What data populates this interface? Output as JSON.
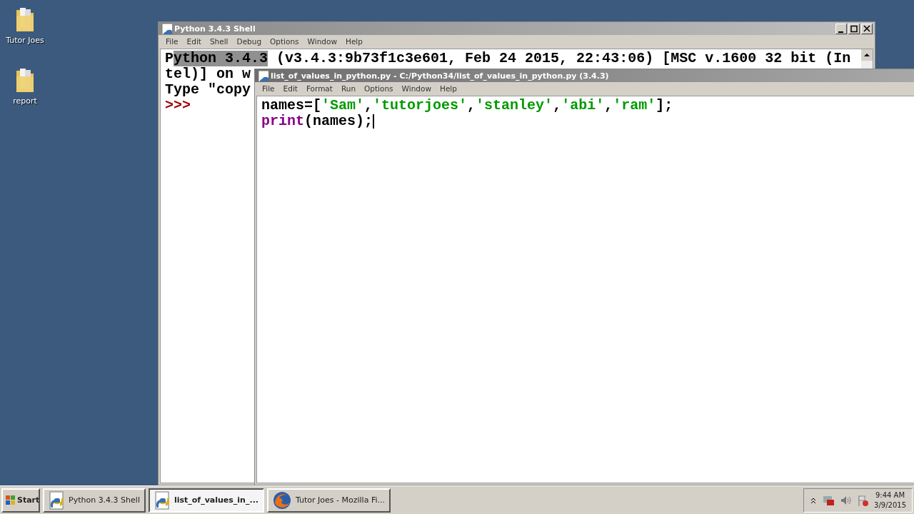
{
  "desktop_icons": [
    {
      "label": "Tutor Joes"
    },
    {
      "label": "report"
    }
  ],
  "shell_window": {
    "title": "Python 3.4.3 Shell",
    "active": false,
    "menu": [
      "File",
      "Edit",
      "Shell",
      "Debug",
      "Options",
      "Window",
      "Help"
    ],
    "lines": [
      [
        {
          "text": "P",
          "selected": false
        },
        {
          "text": "ython 3.4.3",
          "selected": true
        },
        {
          "text": " (v3.4.3:9b73f1c3e601, Feb 24 2015, 22:43:06) [MSC v.1600 32 bit (In",
          "selected": false
        }
      ],
      [
        {
          "text": "tel)] on w",
          "selected": false
        }
      ],
      [
        {
          "text": "Type \"copy",
          "selected": false
        }
      ]
    ],
    "prompt": ">>>"
  },
  "editor_window": {
    "title": "list_of_values_in_python.py - C:/Python34/list_of_values_in_python.py (3.4.3)",
    "active": true,
    "menu": [
      "File",
      "Edit",
      "Format",
      "Run",
      "Options",
      "Window",
      "Help"
    ],
    "code_lines": [
      [
        {
          "text": "names=[",
          "kind": "plain"
        },
        {
          "text": "'Sam'",
          "kind": "string"
        },
        {
          "text": ",",
          "kind": "plain"
        },
        {
          "text": "'tutorjoes'",
          "kind": "string"
        },
        {
          "text": ",",
          "kind": "plain"
        },
        {
          "text": "'stanley'",
          "kind": "string"
        },
        {
          "text": ",",
          "kind": "plain"
        },
        {
          "text": "'abi'",
          "kind": "string"
        },
        {
          "text": ",",
          "kind": "plain"
        },
        {
          "text": "'ram'",
          "kind": "string"
        },
        {
          "text": "];",
          "kind": "plain"
        }
      ],
      [
        {
          "text": "print",
          "kind": "builtin"
        },
        {
          "text": "(names);",
          "kind": "plain"
        }
      ]
    ]
  },
  "taskbar": {
    "start": "Start",
    "tasks": [
      {
        "label": "Python 3.4.3 Shell",
        "kind": "python",
        "selected": false
      },
      {
        "label": "list_of_values_in_...",
        "kind": "python",
        "selected": true
      },
      {
        "label": "Tutor Joes - Mozilla Fi...",
        "kind": "browser",
        "selected": false
      }
    ],
    "clock": {
      "time": "9:44 AM",
      "date": "3/9/2015"
    }
  }
}
